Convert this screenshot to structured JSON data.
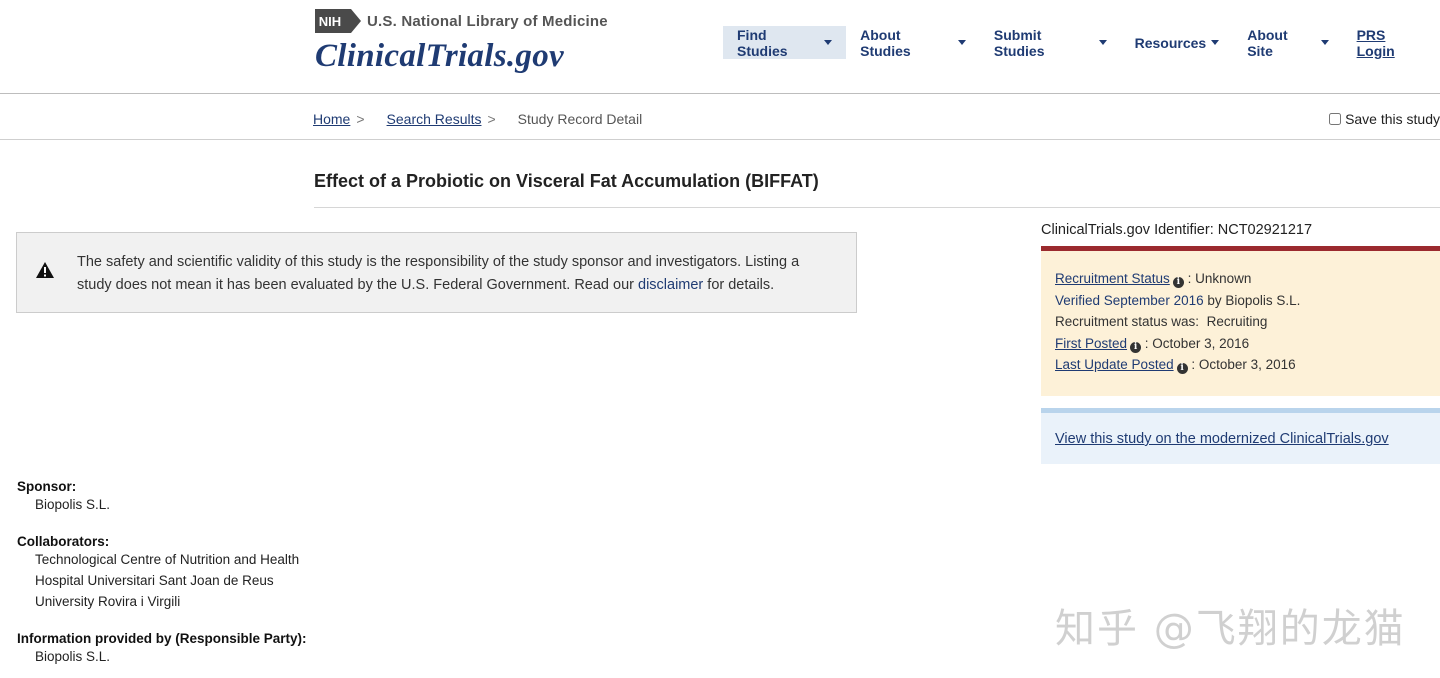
{
  "header": {
    "agency": "U.S. National Library of Medicine",
    "nih_badge": "NIH",
    "brand": "ClinicalTrials.gov",
    "nav": [
      "Find Studies",
      "About Studies",
      "Submit Studies",
      "Resources",
      "About Site"
    ],
    "prs_login": "PRS Login"
  },
  "breadcrumb": {
    "home": "Home",
    "search_results": "Search Results",
    "current": "Study Record Detail",
    "sep": ">"
  },
  "save_study": "Save this study",
  "title": "Effect of a Probiotic on Visceral Fat Accumulation (BIFFAT)",
  "disclaimer": {
    "text_before": "The safety and scientific validity of this study is the responsibility of the study sponsor and investigators. Listing a study does not mean it has been evaluated by the U.S. Federal Government. Read our ",
    "link": "disclaimer",
    "text_after": " for details."
  },
  "identifier": "ClinicalTrials.gov Identifier: NCT02921217",
  "status": {
    "recruitment_label": "Recruitment Status",
    "recruitment_value": ": Unknown",
    "verified_link": "Verified September 2016",
    "verified_by": " by Biopolis S.L.",
    "was_label": "Recruitment status was:",
    "was_value": "Recruiting",
    "first_posted_label": "First Posted",
    "first_posted_value": ": October 3, 2016",
    "last_update_label": "Last Update Posted",
    "last_update_value": ": October 3, 2016"
  },
  "modern_link": "View this study on the modernized ClinicalTrials.gov",
  "sponsor": {
    "label": "Sponsor:",
    "value": "Biopolis S.L."
  },
  "collaborators": {
    "label": "Collaborators:",
    "items": [
      "Technological Centre of Nutrition and Health",
      "Hospital Universitari Sant Joan de Reus",
      "University Rovira i Virgili"
    ]
  },
  "responsible": {
    "label": "Information provided by (Responsible Party):",
    "value": "Biopolis S.L."
  },
  "watermark": "知乎 @飞翔的龙猫",
  "colors": {
    "brand": "#1f3b73",
    "status_border": "#9b2a2e",
    "status_bg": "#fdf1d8",
    "modern_border": "#b9d4ec"
  }
}
